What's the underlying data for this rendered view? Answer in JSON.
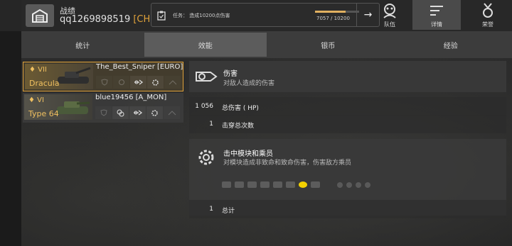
{
  "header": {
    "section_title": "战绩",
    "player_name": "qq1269898519",
    "player_clan": "[CHN"
  },
  "task": {
    "label": "任务：",
    "text": "造成10200点伤害",
    "progress_text": "7057 / 10200",
    "progress": 0.692
  },
  "nav": {
    "squad_label": "队伍",
    "detail_label": "详情",
    "honor_label": "荣誉"
  },
  "tabs": [
    "统计",
    "效能",
    "银币",
    "经验"
  ],
  "active_tab": "效能",
  "tanks": [
    {
      "tier": "♦ VII",
      "name": "Dracula",
      "player": "The_Best_Sniper [EURO]",
      "selected": true
    },
    {
      "tier": "♦ VI",
      "name": "Type 64",
      "player": "blue19456 [A_MON]",
      "selected": false
    }
  ],
  "damage": {
    "title": "伤害",
    "subtitle": "对敌人造成的伤害",
    "rows": [
      {
        "value": "1 056",
        "label": "总伤害 ( HP)"
      },
      {
        "value": "1",
        "label": "击穿总次数"
      }
    ]
  },
  "modules": {
    "title": "击中模块和乘员",
    "subtitle": "对模块造成非致命和致命伤害，伤害敌方乘员",
    "total_value": "1",
    "total_label": "总计"
  },
  "colors": {
    "accent": "#e0a23a",
    "hit_marker": "#f2d000"
  }
}
